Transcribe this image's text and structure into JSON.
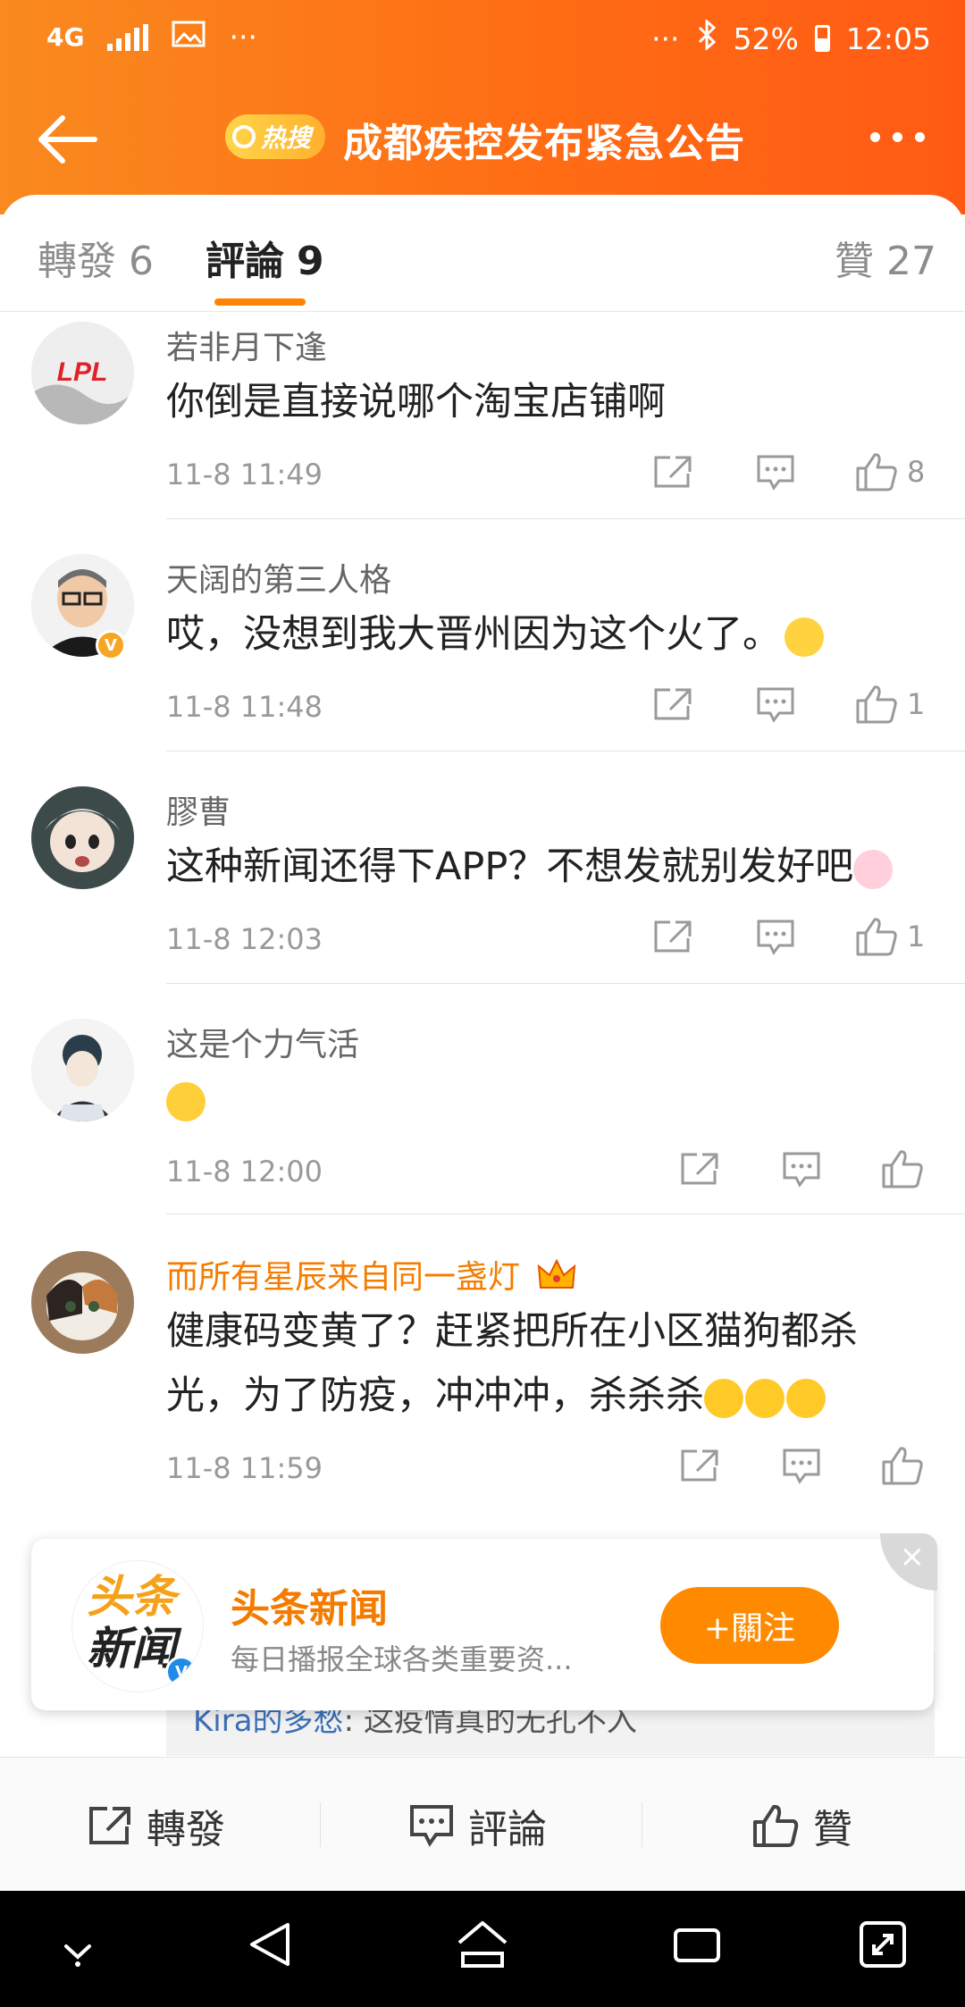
{
  "status_bar": {
    "network": "4G",
    "dots": "···",
    "battery": "52%",
    "time": "12:05"
  },
  "header": {
    "back_icon": "arrow-left-icon",
    "badge": "热搜",
    "title": "成都疾控发布紧急公告",
    "more_icon": "more-dots-icon"
  },
  "tabs": [
    {
      "label": "轉發",
      "count": "6"
    },
    {
      "label": "評論",
      "count": "9"
    },
    {
      "label": "贊",
      "count": "27"
    }
  ],
  "comments": [
    {
      "user": "若非月下逢",
      "text": "你倒是直接说哪个淘宝店铺啊",
      "time": "11-8 11:49",
      "likes": "8"
    },
    {
      "user": "天阔的第三人格",
      "text": "哎，没想到我大晋州因为这个火了。",
      "time": "11-8 11:48",
      "likes": "1"
    },
    {
      "user": "膠曹",
      "text": "这种新闻还得下APP？不想发就别发好吧",
      "time": "11-8 12:03",
      "likes": "1"
    },
    {
      "user": "这是个力气活",
      "text": "",
      "time": "11-8 12:00",
      "likes": ""
    },
    {
      "user": "而所有星辰来自同一盏灯",
      "text_line1": "健康码变黄了？赶紧把所在小区猫狗都杀",
      "text_line2": "光，为了防疫，冲冲冲，杀杀杀",
      "time": "11-8 11:59",
      "likes": ""
    }
  ],
  "reply_peek": {
    "user": "Kira的多愁",
    "text": ": 这疫情真的无孔不入"
  },
  "promo": {
    "logo_line1": "头条",
    "logo_line2": "新闻",
    "name": "头条新闻",
    "desc": "每日播报全球各类重要资...",
    "follow": "+關注",
    "close": "×"
  },
  "bottom_bar": {
    "repost": "轉發",
    "comment": "評論",
    "like": "贊"
  },
  "colors": {
    "brand_orange": "#ff6d14",
    "accent": "#ff8200",
    "vip_name": "#f57c00"
  }
}
